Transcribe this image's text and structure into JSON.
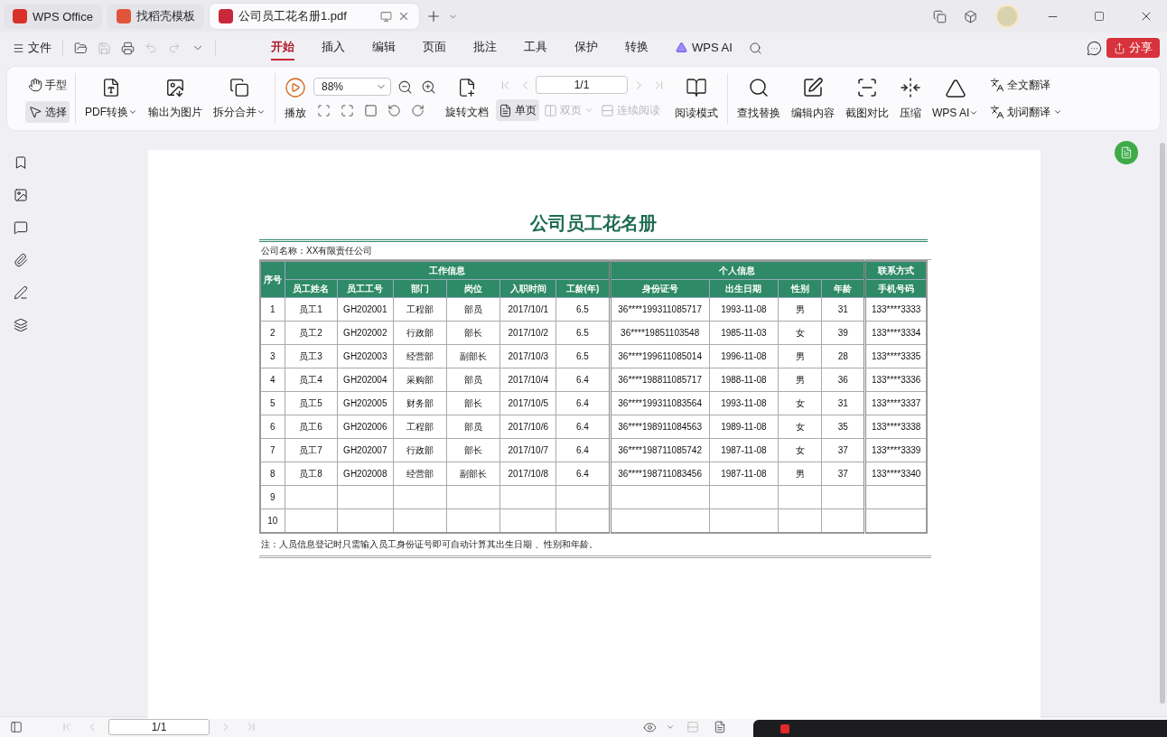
{
  "window_tabs": [
    {
      "label": "WPS Office",
      "kind": "home",
      "selected": false
    },
    {
      "label": "找稻壳模板",
      "kind": "template",
      "selected": false
    },
    {
      "label": "公司员工花名册1.pdf",
      "kind": "pdf",
      "selected": true
    }
  ],
  "menu": {
    "file_label": "文件",
    "tabs": [
      {
        "label": "开始",
        "selected": true,
        "kind": "text"
      },
      {
        "label": "插入",
        "selected": false,
        "kind": "text"
      },
      {
        "label": "编辑",
        "selected": false,
        "kind": "text"
      },
      {
        "label": "页面",
        "selected": false,
        "kind": "text"
      },
      {
        "label": "批注",
        "selected": false,
        "kind": "text"
      },
      {
        "label": "工具",
        "selected": false,
        "kind": "text"
      },
      {
        "label": "保护",
        "selected": false,
        "kind": "text"
      },
      {
        "label": "转换",
        "selected": false,
        "kind": "text"
      },
      {
        "label": "WPS AI",
        "selected": false,
        "kind": "ai"
      }
    ],
    "share_label": "分享"
  },
  "ribbon": {
    "pointer_tools": [
      {
        "label": "手型",
        "selected": false
      },
      {
        "label": "选择",
        "selected": true
      }
    ],
    "convert_tools": [
      {
        "label": "PDF转换",
        "dropdown": true
      },
      {
        "label": "输出为图片",
        "dropdown": false
      },
      {
        "label": "拆分合并",
        "dropdown": true
      }
    ],
    "play_label": "播放",
    "zoom_value": "88%",
    "rotate_label": "旋转文档",
    "page_value": "1/1",
    "view_modes": [
      {
        "label": "单页",
        "selected": true,
        "disabled": false,
        "dropdown": false
      },
      {
        "label": "双页",
        "selected": false,
        "disabled": true,
        "dropdown": true
      },
      {
        "label": "连续阅读",
        "selected": false,
        "disabled": true,
        "dropdown": false
      }
    ],
    "read_mode_label": "阅读模式",
    "edit_tools": [
      {
        "label": "查找替换",
        "dropdown": false
      },
      {
        "label": "编辑内容",
        "dropdown": false
      },
      {
        "label": "截图对比",
        "dropdown": false
      },
      {
        "label": "压缩",
        "dropdown": false
      },
      {
        "label": "WPS AI",
        "dropdown": true
      }
    ],
    "translate_tools": [
      {
        "label": "全文翻译",
        "dropdown": false
      },
      {
        "label": "划词翻译",
        "dropdown": true
      }
    ]
  },
  "document": {
    "title": "公司员工花名册",
    "company": "公司名称：XX有限责任公司",
    "number_header": "序号",
    "groups": [
      {
        "label": "工作信息",
        "columns": [
          "员工姓名",
          "员工工号",
          "部门",
          "岗位",
          "入职时间",
          "工龄(年)"
        ]
      },
      {
        "label": "个人信息",
        "columns": [
          "身份证号",
          "出生日期",
          "性别",
          "年龄"
        ]
      },
      {
        "label": "联系方式",
        "columns": [
          "手机号码"
        ]
      }
    ],
    "rows": [
      {
        "no": "1",
        "cells": [
          "员工1",
          "GH202001",
          "工程部",
          "部员",
          "2017/10/1",
          "6.5",
          "36****199311085717",
          "1993-11-08",
          "男",
          "31",
          "133****3333"
        ]
      },
      {
        "no": "2",
        "cells": [
          "员工2",
          "GH202002",
          "行政部",
          "部长",
          "2017/10/2",
          "6.5",
          "36****19851103548",
          "1985-11-03",
          "女",
          "39",
          "133****3334"
        ]
      },
      {
        "no": "3",
        "cells": [
          "员工3",
          "GH202003",
          "经营部",
          "副部长",
          "2017/10/3",
          "6.5",
          "36****199611085014",
          "1996-11-08",
          "男",
          "28",
          "133****3335"
        ]
      },
      {
        "no": "4",
        "cells": [
          "员工4",
          "GH202004",
          "采购部",
          "部员",
          "2017/10/4",
          "6.4",
          "36****198811085717",
          "1988-11-08",
          "男",
          "36",
          "133****3336"
        ]
      },
      {
        "no": "5",
        "cells": [
          "员工5",
          "GH202005",
          "财务部",
          "部长",
          "2017/10/5",
          "6.4",
          "36****199311083564",
          "1993-11-08",
          "女",
          "31",
          "133****3337"
        ]
      },
      {
        "no": "6",
        "cells": [
          "员工6",
          "GH202006",
          "工程部",
          "部员",
          "2017/10/6",
          "6.4",
          "36****198911084563",
          "1989-11-08",
          "女",
          "35",
          "133****3338"
        ]
      },
      {
        "no": "7",
        "cells": [
          "员工7",
          "GH202007",
          "行政部",
          "部长",
          "2017/10/7",
          "6.4",
          "36****198711085742",
          "1987-11-08",
          "女",
          "37",
          "133****3339"
        ]
      },
      {
        "no": "8",
        "cells": [
          "员工8",
          "GH202008",
          "经营部",
          "副部长",
          "2017/10/8",
          "6.4",
          "36****198711083456",
          "1987-11-08",
          "男",
          "37",
          "133****3340"
        ]
      },
      {
        "no": "9",
        "cells": []
      },
      {
        "no": "10",
        "cells": []
      }
    ],
    "note": "注：人员信息登记时只需输入员工身份证号即可自动计算其出生日期 、性别和年龄。"
  },
  "status_bar": {
    "page_value": "1/1"
  }
}
